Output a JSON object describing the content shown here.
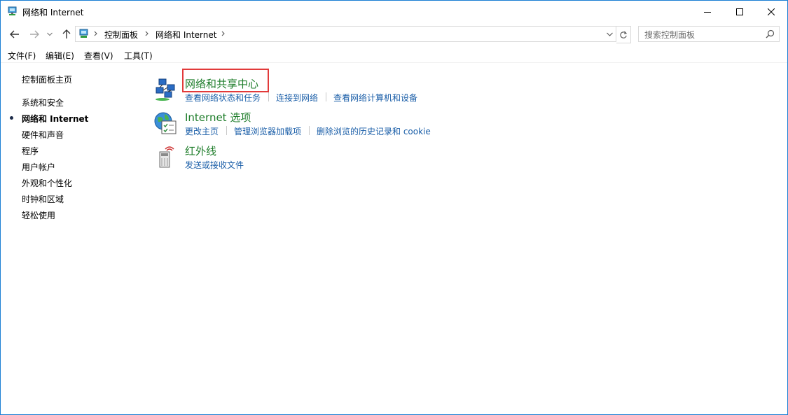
{
  "window": {
    "title": "网络和 Internet",
    "accent_color": "#1a7fd4"
  },
  "address_bar": {
    "crumbs": [
      "控制面板",
      "网络和 Internet"
    ],
    "icons": [
      "back-arrow-icon",
      "forward-arrow-icon",
      "dropdown-icon",
      "up-arrow-icon",
      "control-panel-icon",
      "refresh-icon"
    ]
  },
  "search": {
    "placeholder": "搜索控制面板"
  },
  "menu": {
    "file": "文件(F)",
    "edit": "编辑(E)",
    "view": "查看(V)",
    "tools": "工具(T)"
  },
  "sidebar": {
    "items": [
      {
        "label": "控制面板主页"
      },
      {
        "label": "系统和安全"
      },
      {
        "label": "网络和 Internet",
        "selected": true
      },
      {
        "label": "硬件和声音"
      },
      {
        "label": "程序"
      },
      {
        "label": "用户帐户"
      },
      {
        "label": "外观和个性化"
      },
      {
        "label": "时钟和区域"
      },
      {
        "label": "轻松使用"
      }
    ]
  },
  "categories": [
    {
      "title": "网络和共享中心",
      "icon": "network-sharing-center-icon",
      "links": [
        "查看网络状态和任务",
        "连接到网络",
        "查看网络计算机和设备"
      ]
    },
    {
      "title": "Internet 选项",
      "icon": "internet-options-icon",
      "links": [
        "更改主页",
        "管理浏览器加载项",
        "删除浏览的历史记录和 cookie"
      ]
    },
    {
      "title": "红外线",
      "icon": "infrared-icon",
      "links": [
        "发送或接收文件"
      ]
    }
  ],
  "colors": {
    "category_title": "#1e7d2a",
    "link": "#1a5ea8",
    "highlight_box": "#e23a3a"
  }
}
